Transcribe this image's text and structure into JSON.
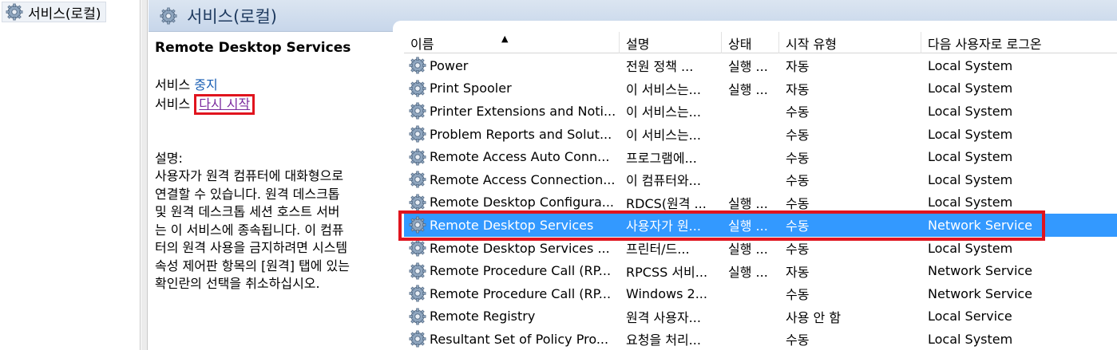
{
  "tree": {
    "label": "서비스(로컬)"
  },
  "header": {
    "title": "서비스(로컬)"
  },
  "description_panel": {
    "service_name": "Remote Desktop Services",
    "stop_prefix": "서비스 ",
    "stop_link": "중지",
    "restart_prefix": "서비스 ",
    "restart_link": "다시 시작",
    "desc_label": "설명:",
    "desc_text": "사용자가 원격 컴퓨터에 대화형으로\n연결할 수 있습니다. 원격 데스크톱\n및 원격 데스크톱 세션 호스트 서버\n는 이 서비스에 종속됩니다. 이 컴퓨\n터의 원격 사용을 금지하려면 시스템\n속성 제어판 항목의 [원격] 탭에 있는\n확인란의 선택을 취소하십시오."
  },
  "columns": {
    "name": "이름",
    "desc": "설명",
    "status": "상태",
    "start": "시작 유형",
    "logon": "다음 사용자로 로그온"
  },
  "rows": [
    {
      "name": "Power",
      "desc": "전원 정책 ...",
      "status": "실행 ...",
      "start": "자동",
      "logon": "Local System"
    },
    {
      "name": "Print Spooler",
      "desc": "이 서비스는...",
      "status": "실행 ...",
      "start": "자동",
      "logon": "Local System"
    },
    {
      "name": "Printer Extensions and Noti...",
      "desc": "이 서비스는...",
      "status": "",
      "start": "수동",
      "logon": "Local System"
    },
    {
      "name": "Problem Reports and Solut...",
      "desc": "이 서비스는...",
      "status": "",
      "start": "수동",
      "logon": "Local System"
    },
    {
      "name": "Remote Access Auto Conn...",
      "desc": "프로그램에...",
      "status": "",
      "start": "수동",
      "logon": "Local System"
    },
    {
      "name": "Remote Access Connection...",
      "desc": "이 컴퓨터와...",
      "status": "",
      "start": "수동",
      "logon": "Local System"
    },
    {
      "name": "Remote Desktop Configura...",
      "desc": "RDCS(원격 ...",
      "status": "실행 ...",
      "start": "수동",
      "logon": "Local System"
    },
    {
      "name": "Remote Desktop Services",
      "desc": "사용자가 원...",
      "status": "실행 ...",
      "start": "수동",
      "logon": "Network Service",
      "selected": true
    },
    {
      "name": "Remote Desktop Services ...",
      "desc": "프린터/드...",
      "status": "실행 ...",
      "start": "수동",
      "logon": "Local System"
    },
    {
      "name": "Remote Procedure Call (RP...",
      "desc": "RPCSS 서비...",
      "status": "실행 ...",
      "start": "자동",
      "logon": "Network Service"
    },
    {
      "name": "Remote Procedure Call (RP...",
      "desc": "Windows 2...",
      "status": "",
      "start": "수동",
      "logon": "Network Service"
    },
    {
      "name": "Remote Registry",
      "desc": "원격 사용자...",
      "status": "",
      "start": "사용 안 함",
      "logon": "Local Service"
    },
    {
      "name": "Resultant Set of Policy Pro...",
      "desc": "요청을 처리...",
      "status": "",
      "start": "수동",
      "logon": "Local System"
    }
  ],
  "colors": {
    "selection": "#3399ff",
    "highlight_box": "#e0141e",
    "header_bg": "#c7d6ea"
  }
}
